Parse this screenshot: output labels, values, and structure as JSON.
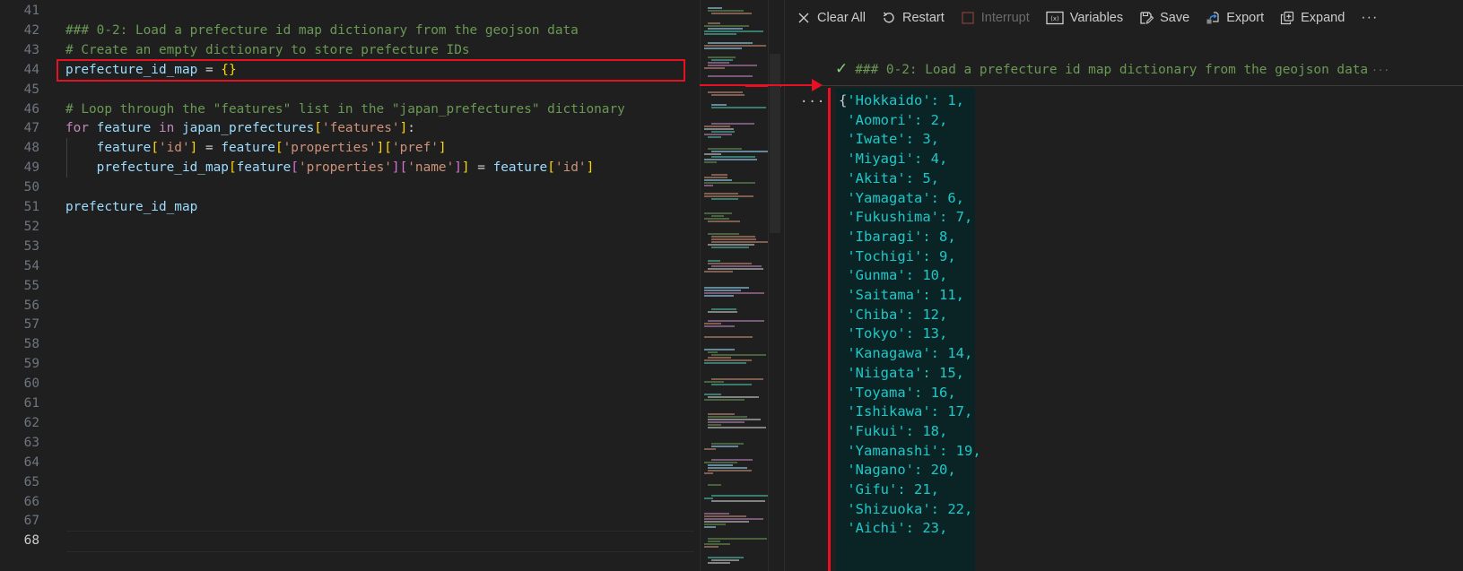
{
  "editor": {
    "lines": [
      {
        "num": "41",
        "tokens": []
      },
      {
        "num": "42",
        "tokens": [
          {
            "t": "### 0-2: Load a prefecture id map dictionary from the geojson data",
            "c": "cm"
          }
        ]
      },
      {
        "num": "43",
        "tokens": [
          {
            "t": "# Create an empty dictionary to store prefecture IDs",
            "c": "cm"
          }
        ]
      },
      {
        "num": "44",
        "tokens": [
          {
            "t": "prefecture_id_map",
            "c": "var"
          },
          {
            "t": " = ",
            "c": "op"
          },
          {
            "t": "{}",
            "c": "b1"
          }
        ]
      },
      {
        "num": "45",
        "tokens": []
      },
      {
        "num": "46",
        "tokens": [
          {
            "t": "# Loop through the \"features\" list in the \"japan_prefectures\" dictionary",
            "c": "cm"
          }
        ]
      },
      {
        "num": "47",
        "tokens": [
          {
            "t": "for",
            "c": "kw"
          },
          {
            "t": " feature ",
            "c": "var"
          },
          {
            "t": "in",
            "c": "kw"
          },
          {
            "t": " japan_prefectures",
            "c": "var"
          },
          {
            "t": "[",
            "c": "b1"
          },
          {
            "t": "'features'",
            "c": "str"
          },
          {
            "t": "]",
            "c": "b1"
          },
          {
            "t": ":",
            "c": "op"
          }
        ]
      },
      {
        "num": "48",
        "tokens": [
          {
            "t": "    feature",
            "c": "var"
          },
          {
            "t": "[",
            "c": "b1"
          },
          {
            "t": "'id'",
            "c": "str"
          },
          {
            "t": "]",
            "c": "b1"
          },
          {
            "t": " = ",
            "c": "op"
          },
          {
            "t": "feature",
            "c": "var"
          },
          {
            "t": "[",
            "c": "b1"
          },
          {
            "t": "'properties'",
            "c": "str"
          },
          {
            "t": "][",
            "c": "b1"
          },
          {
            "t": "'pref'",
            "c": "str"
          },
          {
            "t": "]",
            "c": "b1"
          }
        ]
      },
      {
        "num": "49",
        "tokens": [
          {
            "t": "    prefecture_id_map",
            "c": "var"
          },
          {
            "t": "[",
            "c": "b1"
          },
          {
            "t": "feature",
            "c": "var"
          },
          {
            "t": "[",
            "c": "b2"
          },
          {
            "t": "'properties'",
            "c": "str"
          },
          {
            "t": "][",
            "c": "b2"
          },
          {
            "t": "'name'",
            "c": "str"
          },
          {
            "t": "]",
            "c": "b2"
          },
          {
            "t": "]",
            "c": "b1"
          },
          {
            "t": " = ",
            "c": "op"
          },
          {
            "t": "feature",
            "c": "var"
          },
          {
            "t": "[",
            "c": "b1"
          },
          {
            "t": "'id'",
            "c": "str"
          },
          {
            "t": "]",
            "c": "b1"
          }
        ]
      },
      {
        "num": "50",
        "tokens": []
      },
      {
        "num": "51",
        "tokens": [
          {
            "t": "prefecture_id_map",
            "c": "var"
          }
        ]
      },
      {
        "num": "52",
        "tokens": []
      },
      {
        "num": "53",
        "tokens": []
      },
      {
        "num": "54",
        "tokens": []
      },
      {
        "num": "55",
        "tokens": []
      },
      {
        "num": "56",
        "tokens": []
      },
      {
        "num": "57",
        "tokens": []
      },
      {
        "num": "58",
        "tokens": []
      },
      {
        "num": "59",
        "tokens": []
      },
      {
        "num": "60",
        "tokens": []
      },
      {
        "num": "61",
        "tokens": []
      },
      {
        "num": "62",
        "tokens": []
      },
      {
        "num": "63",
        "tokens": []
      },
      {
        "num": "64",
        "tokens": []
      },
      {
        "num": "65",
        "tokens": []
      },
      {
        "num": "66",
        "tokens": []
      },
      {
        "num": "67",
        "tokens": []
      },
      {
        "num": "68",
        "tokens": [],
        "active": true
      }
    ]
  },
  "toolbar": {
    "clear_all": "Clear All",
    "restart": "Restart",
    "interrupt": "Interrupt",
    "variables": "Variables",
    "save": "Save",
    "export": "Export",
    "expand": "Expand",
    "more": "···"
  },
  "cell": {
    "header": "### 0-2: Load a prefecture id map dictionary from the geojson data",
    "header_more": "···",
    "output_dots": "···",
    "output": [
      {
        "name": "Hokkaido",
        "id": 1
      },
      {
        "name": "Aomori",
        "id": 2
      },
      {
        "name": "Iwate",
        "id": 3
      },
      {
        "name": "Miyagi",
        "id": 4
      },
      {
        "name": "Akita",
        "id": 5
      },
      {
        "name": "Yamagata",
        "id": 6
      },
      {
        "name": "Fukushima",
        "id": 7
      },
      {
        "name": "Ibaragi",
        "id": 8
      },
      {
        "name": "Tochigi",
        "id": 9
      },
      {
        "name": "Gunma",
        "id": 10
      },
      {
        "name": "Saitama",
        "id": 11
      },
      {
        "name": "Chiba",
        "id": 12
      },
      {
        "name": "Tokyo",
        "id": 13
      },
      {
        "name": "Kanagawa",
        "id": 14
      },
      {
        "name": "Niigata",
        "id": 15
      },
      {
        "name": "Toyama",
        "id": 16
      },
      {
        "name": "Ishikawa",
        "id": 17
      },
      {
        "name": "Fukui",
        "id": 18
      },
      {
        "name": "Yamanashi",
        "id": 19
      },
      {
        "name": "Nagano",
        "id": 20
      },
      {
        "name": "Gifu",
        "id": 21
      },
      {
        "name": "Shizuoka",
        "id": 22
      },
      {
        "name": "Aichi",
        "id": 23
      }
    ]
  },
  "colors": {
    "annotation_red": "#e81123",
    "output_text": "#1fc8c8",
    "output_bg": "#0a2426",
    "success_check": "#89d185"
  }
}
